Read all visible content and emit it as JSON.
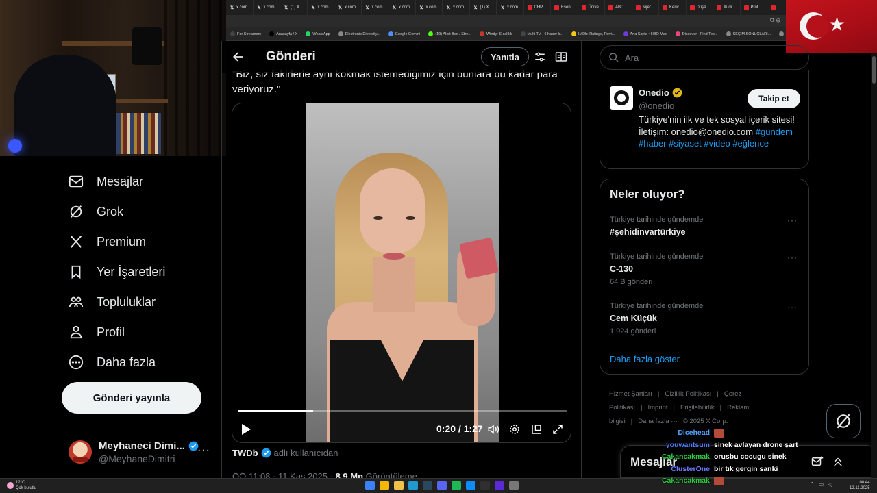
{
  "browser": {
    "tabs": [
      {
        "label": "x.com",
        "icon": "x-icon",
        "color": "#000000"
      },
      {
        "label": "x.com",
        "icon": "x-icon",
        "color": "#000000"
      },
      {
        "label": "(1) X",
        "icon": "x-icon",
        "color": "#000000"
      },
      {
        "label": "x.com",
        "icon": "x-icon",
        "color": "#000000"
      },
      {
        "label": "x.com",
        "icon": "x-icon",
        "color": "#000000"
      },
      {
        "label": "x.com",
        "icon": "x-icon",
        "color": "#000000"
      },
      {
        "label": "x.com",
        "icon": "x-icon",
        "color": "#000000"
      },
      {
        "label": "x.com",
        "icon": "x-icon",
        "color": "#000000"
      },
      {
        "label": "x.com",
        "icon": "x-icon",
        "color": "#000000"
      },
      {
        "label": "(1) X",
        "icon": "x-icon",
        "color": "#000000"
      },
      {
        "label": "x.com",
        "icon": "x-icon",
        "color": "#000000"
      },
      {
        "label": "CHP",
        "icon": "red-square-icon",
        "color": "#e0262d"
      },
      {
        "label": "Esen",
        "icon": "red-square-icon",
        "color": "#e0262d"
      },
      {
        "label": "Ünive",
        "icon": "red-square-icon",
        "color": "#e0262d"
      },
      {
        "label": "ABD",
        "icon": "red-square-icon",
        "color": "#e0262d"
      },
      {
        "label": "Nijer",
        "icon": "red-square-icon",
        "color": "#e0262d"
      },
      {
        "label": "Kenv",
        "icon": "red-square-icon",
        "color": "#e0262d"
      },
      {
        "label": "Düşe",
        "icon": "red-square-icon",
        "color": "#e0262d"
      },
      {
        "label": "Audi",
        "icon": "red-square-icon",
        "color": "#e0262d"
      },
      {
        "label": "Prof.",
        "icon": "red-square-icon",
        "color": "#e0262d"
      },
      {
        "label": "",
        "icon": "red-square-icon",
        "color": "#e0262d"
      }
    ],
    "bookmarks": [
      {
        "label": "For Streamers",
        "color": "#444444"
      },
      {
        "label": "Anasayfa / X",
        "color": "#000000"
      },
      {
        "label": "WhatsApp",
        "color": "#25d366"
      },
      {
        "label": "Electronic Diversity...",
        "color": "#888888"
      },
      {
        "label": "Google Gemini",
        "color": "#4f8ef7"
      },
      {
        "label": "(19) Alert Box / Stre...",
        "color": "#53fc18"
      },
      {
        "label": "Windy: Sıcaklık",
        "color": "#c0392b"
      },
      {
        "label": "Multi TV - 6 haber k...",
        "color": "#444444"
      },
      {
        "label": "IMDb: Ratings, Revi...",
        "color": "#f5c518"
      },
      {
        "label": "Ana Sayfa • HBO Max",
        "color": "#6c3bd8"
      },
      {
        "label": "Discover - Find Top...",
        "color": "#e8467c"
      },
      {
        "label": "SEÇİM SONUÇLARI...",
        "color": "#888888"
      },
      {
        "label": "Ch",
        "color": "#888888"
      }
    ]
  },
  "nav": {
    "items": [
      {
        "label": "Mesajlar",
        "icon": "envelope-icon"
      },
      {
        "label": "Grok",
        "icon": "grok-icon"
      },
      {
        "label": "Premium",
        "icon": "x-logo-icon"
      },
      {
        "label": "Yer İşaretleri",
        "icon": "bookmark-icon"
      },
      {
        "label": "Topluluklar",
        "icon": "communities-icon"
      },
      {
        "label": "Profil",
        "icon": "person-icon"
      },
      {
        "label": "Daha fazla",
        "icon": "more-circle-icon"
      }
    ],
    "post_button": "Gönderi yayınla",
    "account": {
      "name": "Meyhaneci Dimi...",
      "handle": "@MeyhaneDimitri",
      "more": "···"
    }
  },
  "post": {
    "title": "Gönderi",
    "reply_button": "Yanıtla",
    "text": "\"Biz, siz fakirlerle aynı kokmak istemediğimiz için bunlara bu kadar para veriyoruz.\"",
    "video": {
      "time": "0:20 / 1:27",
      "progress": 0.23
    },
    "source_user": "TWDb",
    "source_suffix": "adlı kullanıcıdan",
    "timestamp": "ÖÖ 11:08 · 11 Kas 2025 ·",
    "views_count": "8,9 Mn",
    "views_label": "Görüntüleme"
  },
  "sidebar": {
    "search_placeholder": "Ara",
    "profile": {
      "name": "Onedio",
      "handle": "@onedio",
      "follow_button": "Takip et",
      "bio_text": "Türkiye'nin ilk ve tek sosyal içerik sitesi! İletişim: onedio@onedio.com",
      "bio_tags": "#gündem #haber #siyaset #video #eğlence"
    },
    "trends_title": "Neler oluyor?",
    "trends": [
      {
        "context": "Türkiye tarihinde gündemde",
        "name": "#şehidinvartürkiye",
        "count": ""
      },
      {
        "context": "Türkiye tarihinde gündemde",
        "name": "C-130",
        "count": "64 B gönderi"
      },
      {
        "context": "Türkiye tarihinde gündemde",
        "name": "Cem Küçük",
        "count": "1.924 gönderi"
      }
    ],
    "show_more": "Daha fazla göster",
    "footer": [
      "Hizmet Şartları",
      "|",
      "Gizlilik Politikası",
      "|",
      "Çerez Politikası",
      "|",
      "Imprint",
      "|",
      "Erişilebilirlik",
      "|",
      "Reklam bilgisi",
      "|",
      "Daha fazla ···",
      "© 2025 X Corp."
    ],
    "messages_title": "Mesajlar"
  },
  "chat": [
    {
      "user": "Dicehead",
      "color": "#4ea3ff",
      "message": "",
      "emote": true
    },
    {
      "user": "youwantsum",
      "color": "#4f7dff",
      "message": "sinek avlayan drone şart",
      "emote": false
    },
    {
      "user": "Cakancakmak",
      "color": "#2ecc40",
      "message": "orusbu cocugu sinek",
      "emote": false
    },
    {
      "user": "ClusterOne",
      "color": "#6f7bff",
      "message": "bir tık gergin sanki",
      "emote": false
    },
    {
      "user": "Cakancakmak",
      "color": "#2ecc40",
      "message": "",
      "emote": true
    }
  ],
  "taskbar": {
    "weather_temp": "12°C",
    "weather_desc": "Çok bulutlu",
    "time": "08:44",
    "date": "12.11.2025",
    "apps": [
      {
        "icon": "windows-start-icon",
        "color": "#3b82f6"
      },
      {
        "icon": "chrome-icon",
        "color": "#f2b705"
      },
      {
        "icon": "file-explorer-icon",
        "color": "#f0c24a"
      },
      {
        "icon": "edge-icon",
        "color": "#1f9bd1"
      },
      {
        "icon": "steam-icon",
        "color": "#2a475e"
      },
      {
        "icon": "discord-icon",
        "color": "#5865f2"
      },
      {
        "icon": "spotify-icon",
        "color": "#1db954"
      },
      {
        "icon": "app-icon",
        "color": "#0f8cfc"
      },
      {
        "icon": "obs-icon",
        "color": "#302e31"
      },
      {
        "icon": "app-icon",
        "color": "#5a2ad8"
      },
      {
        "icon": "settings-icon",
        "color": "#777777"
      }
    ]
  }
}
